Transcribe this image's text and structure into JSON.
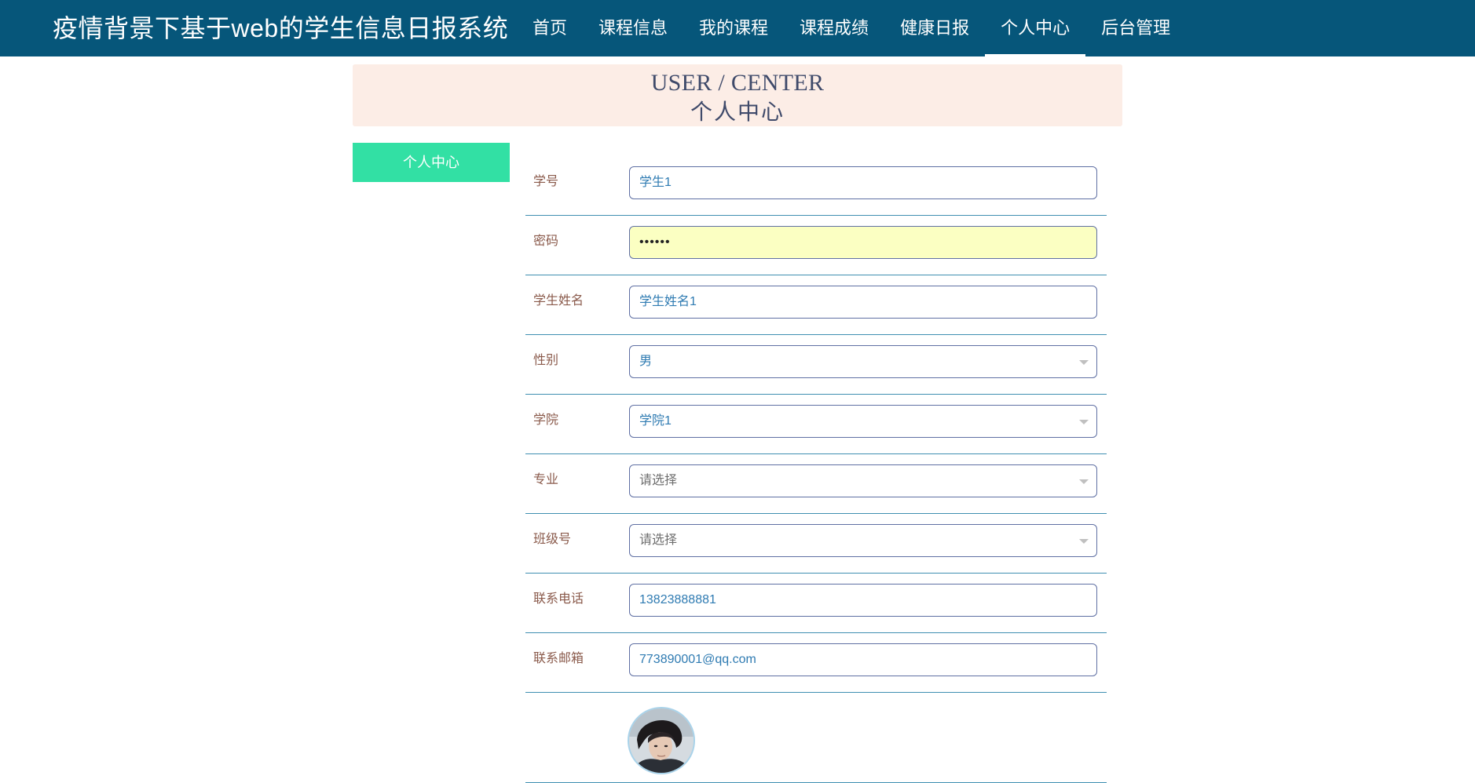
{
  "app": {
    "title": "疫情背景下基于web的学生信息日报系统"
  },
  "nav": {
    "items": [
      {
        "label": "首页"
      },
      {
        "label": "课程信息"
      },
      {
        "label": "我的课程"
      },
      {
        "label": "课程成绩"
      },
      {
        "label": "健康日报"
      },
      {
        "label": "个人中心"
      },
      {
        "label": "后台管理"
      }
    ],
    "active_index": 5
  },
  "banner": {
    "en": "USER / CENTER",
    "cn": "个人中心"
  },
  "sidebar": {
    "tab_label": "个人中心"
  },
  "form": {
    "student_id": {
      "label": "学号",
      "value": "学生1"
    },
    "password": {
      "label": "密码",
      "value": "••••••"
    },
    "student_name": {
      "label": "学生姓名",
      "value": "学生姓名1"
    },
    "gender": {
      "label": "性别",
      "value": "男"
    },
    "college": {
      "label": "学院",
      "value": "学院1"
    },
    "major": {
      "label": "专业",
      "value": "请选择"
    },
    "class_no": {
      "label": "班级号",
      "value": "请选择"
    },
    "phone": {
      "label": "联系电话",
      "value": "13823888881"
    },
    "email": {
      "label": "联系邮箱",
      "value": "773890001@qq.com"
    }
  },
  "colors": {
    "topbar": "#06567a",
    "banner_bg": "#fcede6",
    "side_tab": "#32e0a4",
    "label": "#8a5a4b",
    "value": "#2f7bb2",
    "password_bg": "#fbffc2"
  }
}
